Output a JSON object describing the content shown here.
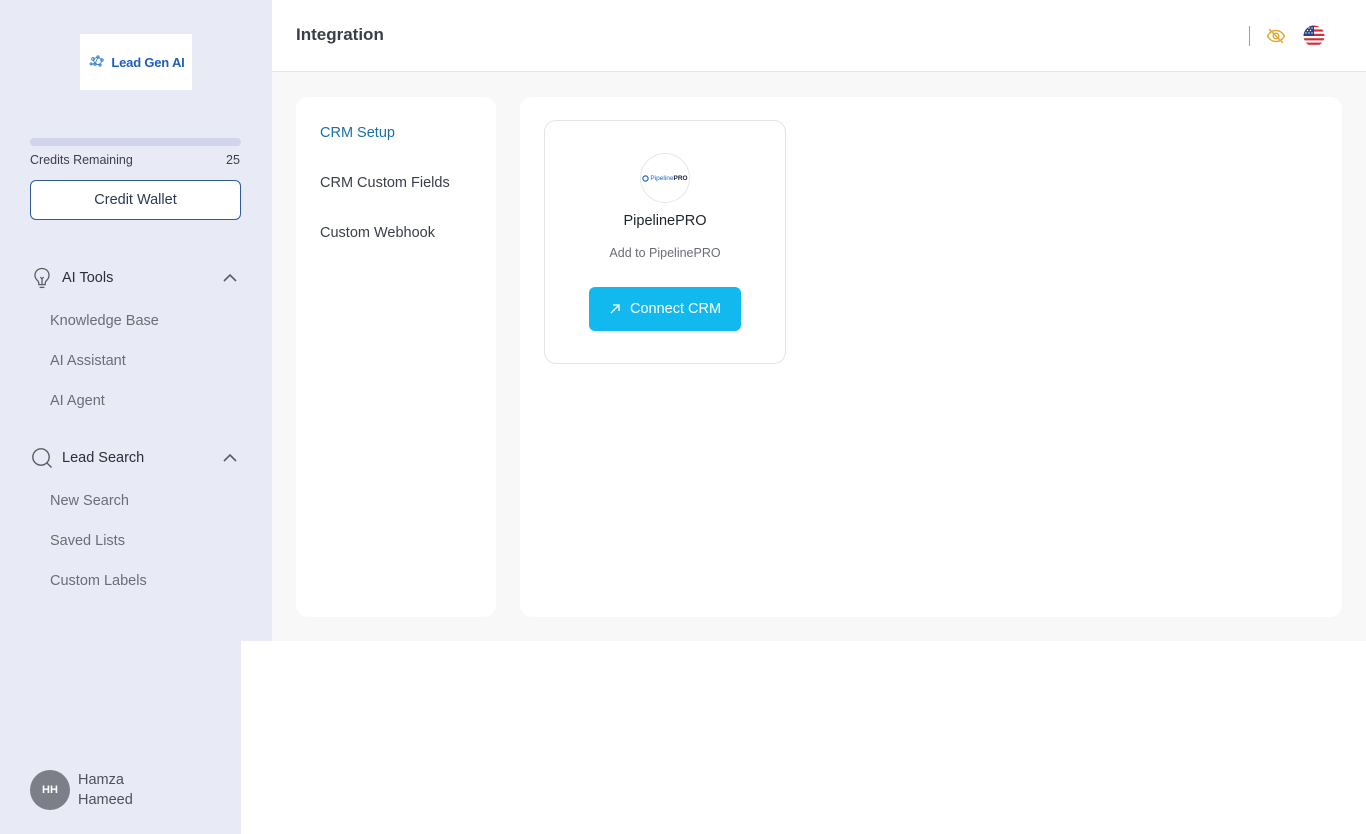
{
  "app": {
    "logo_text": "Lead Gen AI"
  },
  "sidebar": {
    "credits": {
      "label": "Credits Remaining",
      "value": "25",
      "used_fraction": 0.0
    },
    "credit_wallet_label": "Credit Wallet",
    "sections": [
      {
        "label": "AI Tools",
        "icon": "lightbulb-icon",
        "expanded": true,
        "items": [
          {
            "label": "Knowledge Base"
          },
          {
            "label": "AI Assistant"
          },
          {
            "label": "AI Agent"
          }
        ]
      },
      {
        "label": "Lead Search",
        "icon": "search-icon",
        "expanded": true,
        "items": [
          {
            "label": "New Search"
          },
          {
            "label": "Saved Lists"
          },
          {
            "label": "Custom Labels"
          }
        ]
      }
    ],
    "user": {
      "initials": "HH",
      "name": "Hamza Hameed"
    }
  },
  "header": {
    "title": "Integration",
    "icons": [
      "eye-off-icon",
      "us-flag-icon"
    ]
  },
  "settings_nav": {
    "items": [
      {
        "label": "CRM Setup",
        "active": true
      },
      {
        "label": "CRM Custom Fields",
        "active": false
      },
      {
        "label": "Custom Webhook",
        "active": false
      }
    ]
  },
  "crm_card": {
    "logo_text_prefix": "Pipeline",
    "logo_text_suffix": "PRO",
    "name": "PipelinePRO",
    "description": "Add to PipelinePRO",
    "connect_label": "Connect CRM"
  },
  "colors": {
    "sidebar_bg": "#e8eaf6",
    "accent": "#12b9ee",
    "active_link": "#1c6fa8",
    "wallet_border": "#2f5b9a"
  }
}
